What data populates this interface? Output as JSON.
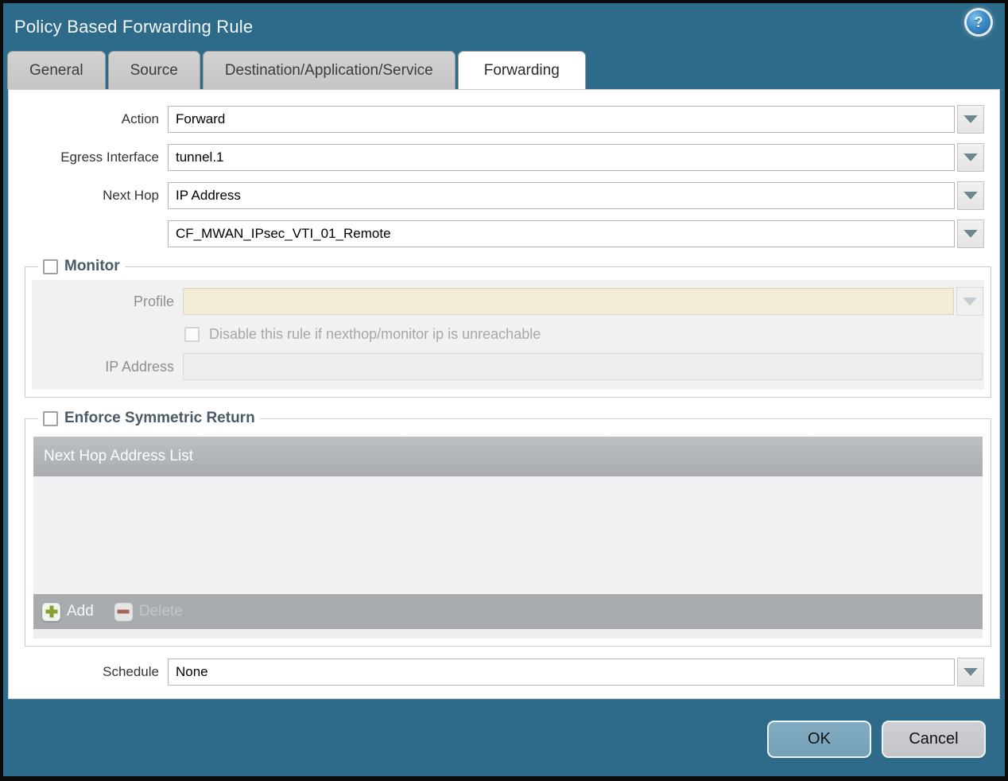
{
  "dialog": {
    "title": "Policy Based Forwarding Rule"
  },
  "tabs": [
    {
      "label": "General",
      "active": false
    },
    {
      "label": "Source",
      "active": false
    },
    {
      "label": "Destination/Application/Service",
      "active": false
    },
    {
      "label": "Forwarding",
      "active": true
    }
  ],
  "form": {
    "action": {
      "label": "Action",
      "value": "Forward"
    },
    "egress_interface": {
      "label": "Egress Interface",
      "value": "tunnel.1"
    },
    "next_hop": {
      "label": "Next Hop",
      "value": "IP Address"
    },
    "next_hop_address": {
      "value": "CF_MWAN_IPsec_VTI_01_Remote"
    },
    "schedule": {
      "label": "Schedule",
      "value": "None"
    }
  },
  "monitor": {
    "legend": "Monitor",
    "checked": false,
    "profile": {
      "label": "Profile",
      "value": ""
    },
    "disable_rule_checkbox": {
      "label": "Disable this rule if nexthop/monitor ip is unreachable",
      "checked": false
    },
    "ip_address": {
      "label": "IP Address",
      "value": ""
    }
  },
  "enforce_symmetric_return": {
    "legend": "Enforce Symmetric Return",
    "checked": false,
    "table": {
      "header": "Next Hop Address List",
      "rows": []
    },
    "add_label": "Add",
    "delete_label": "Delete",
    "delete_enabled": false
  },
  "footer": {
    "ok_label": "OK",
    "cancel_label": "Cancel"
  },
  "icons": {
    "help": "question-mark",
    "dropdown": "chevron-down",
    "add": "green-plus",
    "delete": "red-minus"
  },
  "colors": {
    "titlebar_teal": "#2e6b8a",
    "tab_inactive_gray": "#c9c9c9",
    "profile_disabled_bg": "#f2ecd9",
    "table_header_gray": "#b0b4b8",
    "toolbar_gray": "#a8acaf",
    "add_icon_green": "#85a233",
    "delete_icon_red": "#aa5a4d",
    "ok_button_blue": "#7aa6bc",
    "cancel_button_gray": "#c8c9cc"
  }
}
